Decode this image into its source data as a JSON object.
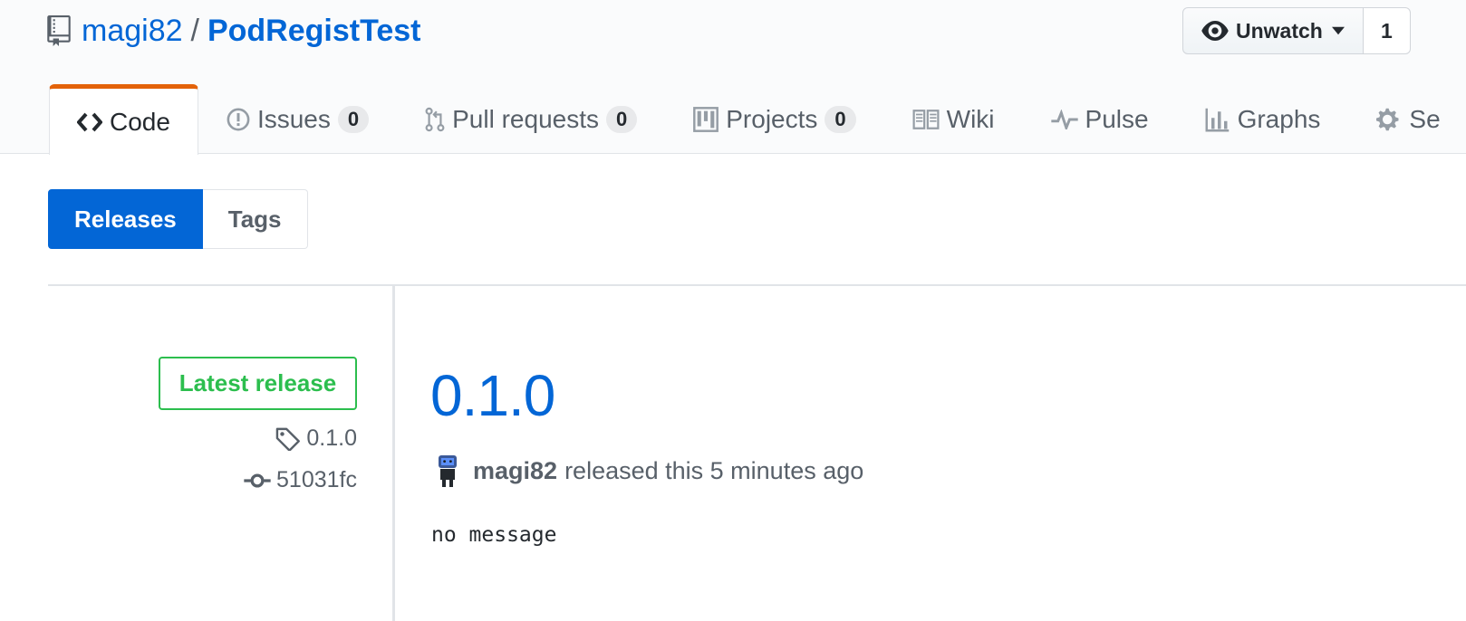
{
  "repo": {
    "owner": "magi82",
    "separator": "/",
    "name": "PodRegistTest"
  },
  "watch": {
    "label": "Unwatch",
    "count": "1"
  },
  "tabs": [
    {
      "label": "Code",
      "icon": "code-icon",
      "selected": true
    },
    {
      "label": "Issues",
      "count": "0",
      "icon": "issue-opened-icon"
    },
    {
      "label": "Pull requests",
      "count": "0",
      "icon": "git-pull-request-icon"
    },
    {
      "label": "Projects",
      "count": "0",
      "icon": "project-icon"
    },
    {
      "label": "Wiki",
      "icon": "book-icon"
    },
    {
      "label": "Pulse",
      "icon": "pulse-icon"
    },
    {
      "label": "Graphs",
      "icon": "graph-icon"
    },
    {
      "label": "Se",
      "icon": "gear-icon"
    }
  ],
  "subnav": {
    "releases_label": "Releases",
    "tags_label": "Tags"
  },
  "release": {
    "badge": "Latest release",
    "tag": "0.1.0",
    "commit": "51031fc",
    "title": "0.1.0",
    "author": "magi82",
    "released_text": "released this 5 minutes ago",
    "body": "no message"
  },
  "colors": {
    "link": "#0366d6",
    "accent_tab": "#e36209",
    "latest_green": "#2cbe4e"
  }
}
